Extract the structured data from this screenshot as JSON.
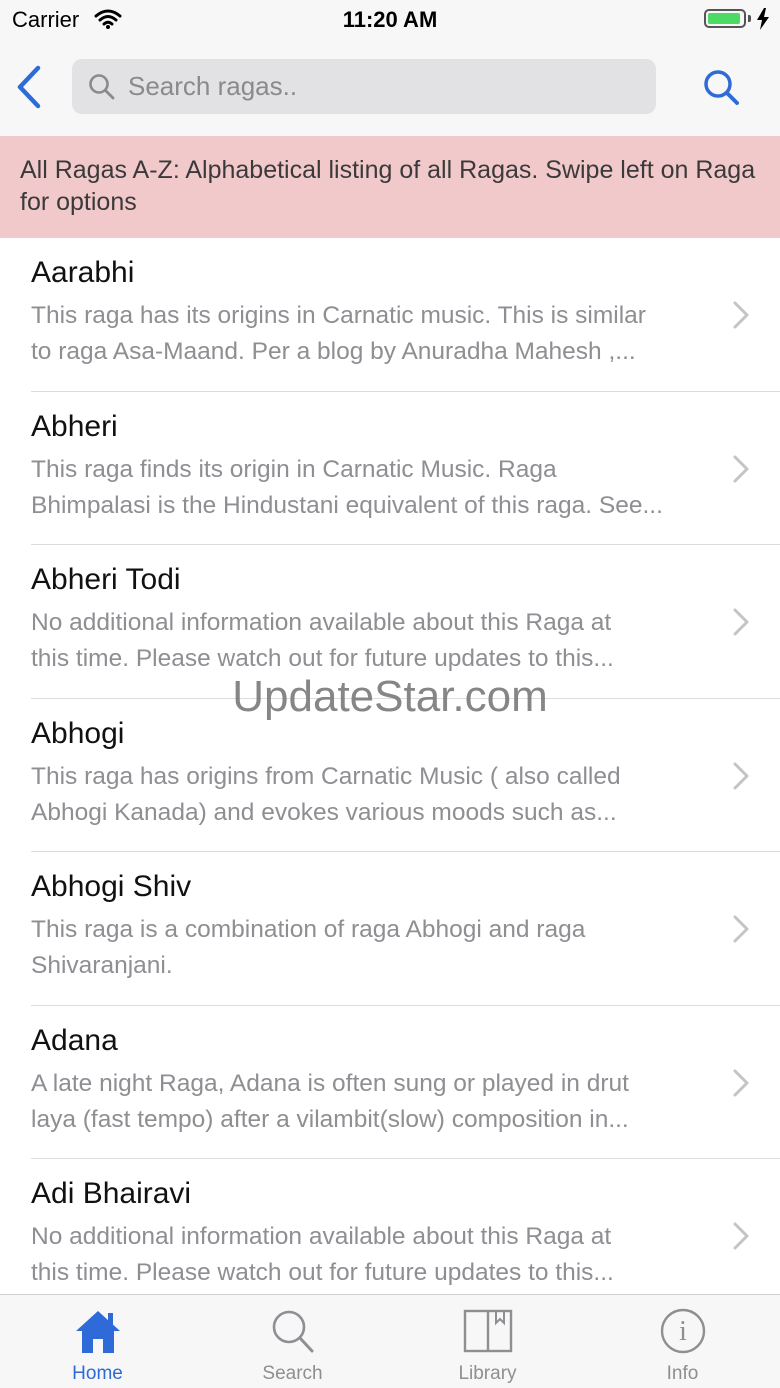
{
  "status_bar": {
    "carrier": "Carrier",
    "time": "11:20 AM",
    "battery_level": 0.95
  },
  "search": {
    "placeholder": "Search ragas..",
    "value": ""
  },
  "banner": {
    "text": "All Ragas A-Z: Alphabetical listing of all Ragas. Swipe left on Raga for options"
  },
  "ragas": [
    {
      "name": "Aarabhi",
      "desc_line1": "This raga has its origins in Carnatic music. This is similar",
      "desc_line2": "to raga Asa-Maand. Per a blog by Anuradha Mahesh ,..."
    },
    {
      "name": "Abheri",
      "desc_line1": "This raga finds its origin in Carnatic Music. Raga",
      "desc_line2": "Bhimpalasi is the Hindustani equivalent of this raga. See..."
    },
    {
      "name": "Abheri Todi",
      "desc_line1": "No additional information available about this Raga at",
      "desc_line2": "this time. Please watch out for future updates to this..."
    },
    {
      "name": "Abhogi",
      "desc_line1": "This raga has origins from Carnatic Music ( also called",
      "desc_line2": "Abhogi Kanada) and evokes various moods such as..."
    },
    {
      "name": "Abhogi Shiv",
      "desc_line1": "This raga is a combination of raga Abhogi and raga",
      "desc_line2": "Shivaranjani."
    },
    {
      "name": "Adana",
      "desc_line1": "A late night Raga, Adana is often sung or played in drut",
      "desc_line2": "laya (fast tempo) after a vilambit(slow) composition in..."
    },
    {
      "name": "Adi Bhairavi",
      "desc_line1": "No additional information available about this Raga at",
      "desc_line2": "this time. Please watch out for future updates to this..."
    }
  ],
  "watermark": "UpdateStar.com",
  "tabs": [
    {
      "label": "Home",
      "icon": "home-icon",
      "active": true
    },
    {
      "label": "Search",
      "icon": "search-icon",
      "active": false
    },
    {
      "label": "Library",
      "icon": "book-icon",
      "active": false
    },
    {
      "label": "Info",
      "icon": "info-icon",
      "active": false
    }
  ],
  "colors": {
    "accent": "#2f6bd8",
    "banner_bg": "#f2c9cb",
    "battery_green": "#4cd964",
    "secondary_text": "#8e8e93"
  }
}
